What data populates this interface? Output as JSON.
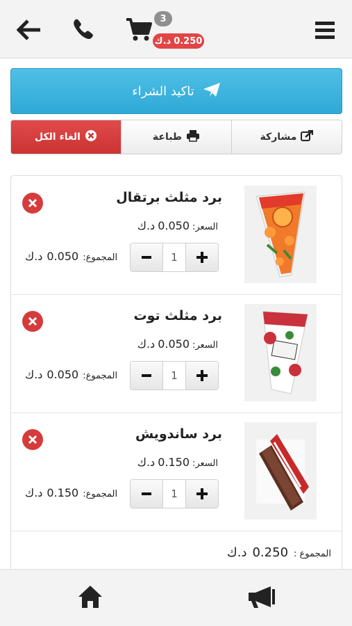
{
  "header": {
    "cart_count": "3",
    "cart_total_value": "0.250",
    "cart_total_currency": "د.ك",
    "icons": [
      "back-arrow-icon",
      "phone-icon",
      "cart-icon",
      "menu-icon"
    ]
  },
  "confirm_button": {
    "label": "تاكيد الشراء",
    "icon": "paper-plane-icon"
  },
  "actions": {
    "share": {
      "label": "مشاركة",
      "icon": "share-icon"
    },
    "print": {
      "label": "طباعة",
      "icon": "print-icon"
    },
    "clear": {
      "label": "الغاء الكل",
      "icon": "close-circle-icon"
    }
  },
  "labels": {
    "price": "السعر:",
    "total": "المجموع:",
    "grand_total": "المجموع :",
    "currency": "د.ك"
  },
  "items": [
    {
      "name": "برد مثلث برتقال",
      "price": "0.050",
      "quantity": "1",
      "total": "0.050"
    },
    {
      "name": "برد مثلث توت",
      "price": "0.050",
      "quantity": "1",
      "total": "0.050"
    },
    {
      "name": "برد ساندويش",
      "price": "0.150",
      "quantity": "1",
      "total": "0.150"
    }
  ],
  "grand_total": "0.250",
  "colors": {
    "confirm": "#2fa8d6",
    "clear": "#cc3333",
    "badge_total": "#e24545",
    "badge_count": "#8f8f8f"
  },
  "bottom_bar": {
    "icons": [
      "home-icon",
      "megaphone-icon"
    ]
  }
}
